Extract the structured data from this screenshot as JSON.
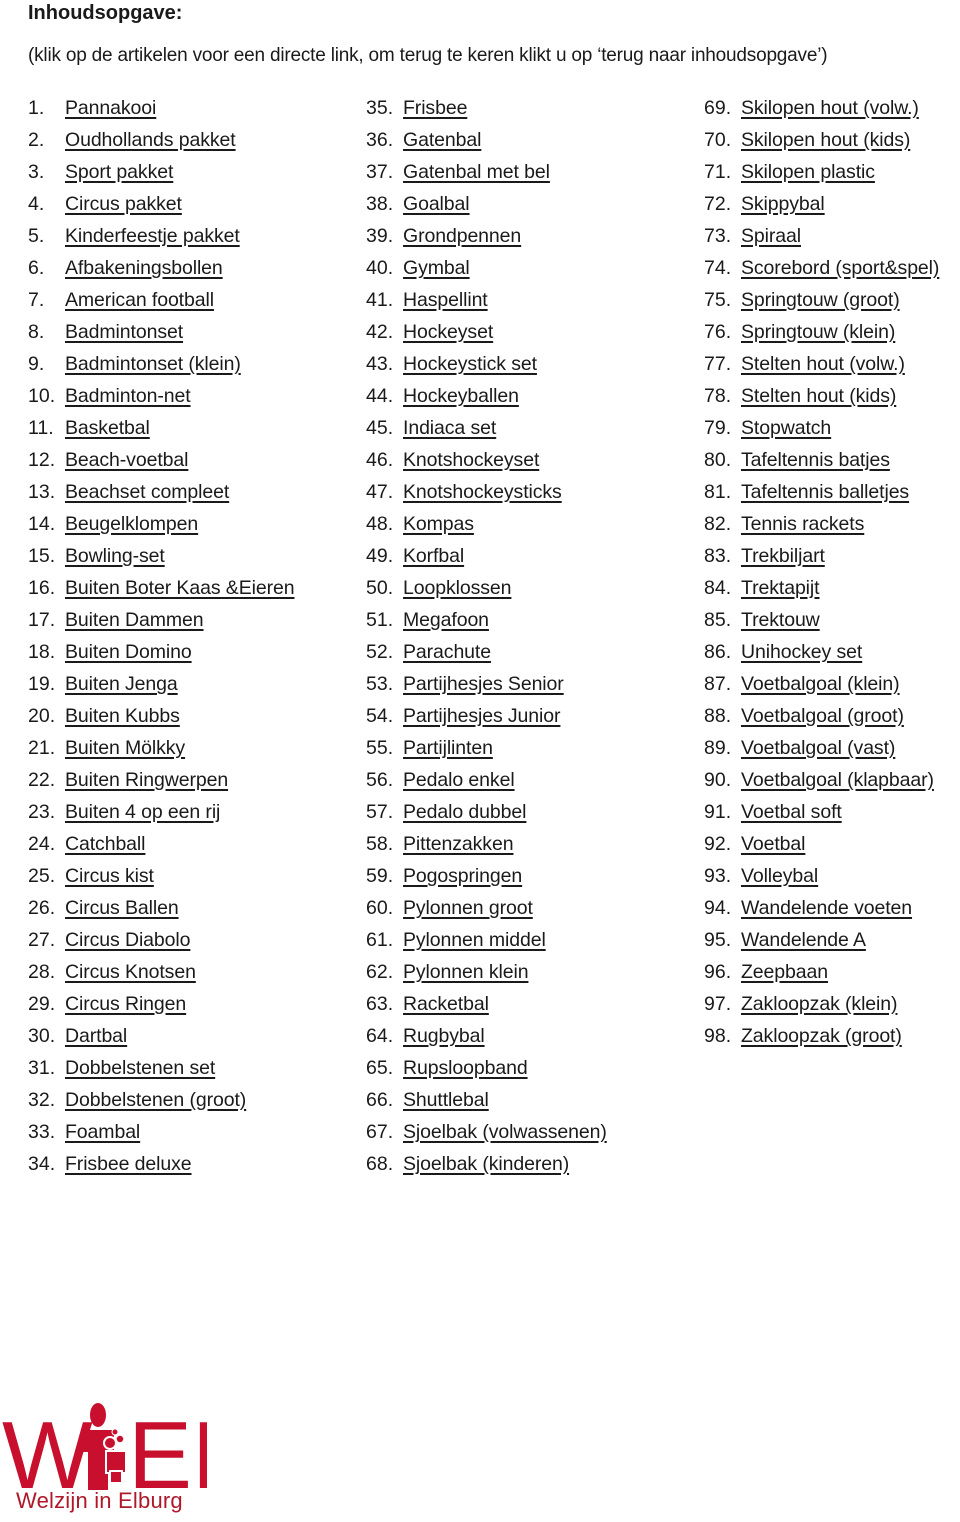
{
  "title": "Inhoudsopgave:",
  "subtitle": "(klik op de artikelen voor een directe link, om terug te keren klikt u op ‘terug naar inhoudsopgave’)",
  "columns": [
    {
      "items": [
        {
          "num": "1.",
          "label": "Pannakooi"
        },
        {
          "num": "2.",
          "label": "Oudhollands pakket"
        },
        {
          "num": "3.",
          "label": "Sport pakket"
        },
        {
          "num": "4.",
          "label": "Circus pakket"
        },
        {
          "num": "5.",
          "label": "Kinderfeestje pakket"
        },
        {
          "num": "6.",
          "label": "Afbakeningsbollen"
        },
        {
          "num": "7.",
          "label": "American football"
        },
        {
          "num": "8.",
          "label": "Badmintonset"
        },
        {
          "num": "9.",
          "label": "Badmintonset (klein)"
        },
        {
          "num": "10.",
          "label": "Badminton-net"
        },
        {
          "num": "11.",
          "label": "Basketbal"
        },
        {
          "num": "12.",
          "label": "Beach-voetbal"
        },
        {
          "num": "13.",
          "label": "Beachset compleet"
        },
        {
          "num": "14.",
          "label": "Beugelklompen"
        },
        {
          "num": "15.",
          "label": "Bowling-set"
        },
        {
          "num": "16.",
          "label": "Buiten Boter Kaas &Eieren"
        },
        {
          "num": "17.",
          "label": "Buiten Dammen"
        },
        {
          "num": "18.",
          "label": "Buiten Domino"
        },
        {
          "num": "19.",
          "label": "Buiten Jenga"
        },
        {
          "num": "20.",
          "label": "Buiten Kubbs"
        },
        {
          "num": "21.",
          "label": "Buiten Mölkky"
        },
        {
          "num": "22.",
          "label": "Buiten Ringwerpen"
        },
        {
          "num": "23.",
          "label": "Buiten 4 op een rij"
        },
        {
          "num": "24.",
          "label": "Catchball"
        },
        {
          "num": "25.",
          "label": "Circus kist"
        },
        {
          "num": "26.",
          "label": "Circus Ballen"
        },
        {
          "num": "27.",
          "label": "Circus Diabolo"
        },
        {
          "num": "28.",
          "label": "Circus Knotsen"
        },
        {
          "num": "29.",
          "label": "Circus Ringen"
        },
        {
          "num": "30.",
          "label": "Dartbal"
        },
        {
          "num": "31.",
          "label": "Dobbelstenen set"
        },
        {
          "num": "32.",
          "label": "Dobbelstenen (groot)"
        },
        {
          "num": "33.",
          "label": "Foambal"
        },
        {
          "num": "34.",
          "label": "Frisbee deluxe"
        }
      ]
    },
    {
      "items": [
        {
          "num": "35.",
          "label": "Frisbee"
        },
        {
          "num": "36.",
          "label": "Gatenbal"
        },
        {
          "num": "37.",
          "label": "Gatenbal met bel"
        },
        {
          "num": "38.",
          "label": "Goalbal"
        },
        {
          "num": "39.",
          "label": "Grondpennen"
        },
        {
          "num": "40.",
          "label": "Gymbal"
        },
        {
          "num": "41.",
          "label": "Haspellint"
        },
        {
          "num": "42.",
          "label": "Hockeyset"
        },
        {
          "num": "43.",
          "label": "Hockeystick set"
        },
        {
          "num": "44.",
          "label": "Hockeyballen"
        },
        {
          "num": "45.",
          "label": "Indiaca set"
        },
        {
          "num": "46.",
          "label": "Knotshockeyset"
        },
        {
          "num": "47.",
          "label": "Knotshockeysticks"
        },
        {
          "num": "48.",
          "label": "Kompas"
        },
        {
          "num": "49.",
          "label": "Korfbal"
        },
        {
          "num": "50.",
          "label": "Loopklossen"
        },
        {
          "num": "51.",
          "label": "Megafoon"
        },
        {
          "num": "52.",
          "label": "Parachute"
        },
        {
          "num": "53.",
          "label": "Partijhesjes Senior"
        },
        {
          "num": "54.",
          "label": "Partijhesjes Junior"
        },
        {
          "num": "55.",
          "label": "Partijlinten"
        },
        {
          "num": "56.",
          "label": "Pedalo enkel"
        },
        {
          "num": "57.",
          "label": "Pedalo dubbel"
        },
        {
          "num": "58.",
          "label": "Pittenzakken"
        },
        {
          "num": "59.",
          "label": "Pogospringen"
        },
        {
          "num": "60.",
          "label": "Pylonnen groot"
        },
        {
          "num": "61.",
          "label": "Pylonnen middel"
        },
        {
          "num": "62.",
          "label": "Pylonnen klein"
        },
        {
          "num": "63.",
          "label": "Racketbal"
        },
        {
          "num": "64.",
          "label": "Rugbybal"
        },
        {
          "num": "65.",
          "label": "Rupsloopband"
        },
        {
          "num": "66.",
          "label": "Shuttlebal"
        },
        {
          "num": "67.",
          "label": "Sjoelbak (volwassenen)"
        },
        {
          "num": "68.",
          "label": "Sjoelbak (kinderen)"
        }
      ]
    },
    {
      "items": [
        {
          "num": "69.",
          "label": "Skilopen hout (volw.)"
        },
        {
          "num": "70.",
          "label": "Skilopen hout (kids)"
        },
        {
          "num": "71.",
          "label": "Skilopen plastic"
        },
        {
          "num": "72.",
          "label": "Skippybal"
        },
        {
          "num": "73.",
          "label": "Spiraal"
        },
        {
          "num": "74.",
          "label": "Scorebord (sport&spel)"
        },
        {
          "num": "75.",
          "label": "Springtouw (groot)"
        },
        {
          "num": "76.",
          "label": "Springtouw (klein)"
        },
        {
          "num": "77.",
          "label": "Stelten hout (volw.)"
        },
        {
          "num": "78.",
          "label": "Stelten hout (kids)"
        },
        {
          "num": "79.",
          "label": "Stopwatch"
        },
        {
          "num": "80.",
          "label": "Tafeltennis batjes"
        },
        {
          "num": "81.",
          "label": "Tafeltennis balletjes"
        },
        {
          "num": "82.",
          "label": "Tennis rackets"
        },
        {
          "num": "83.",
          "label": "Trekbiljart"
        },
        {
          "num": "84.",
          "label": "Trektapijt"
        },
        {
          "num": "85.",
          "label": "Trektouw"
        },
        {
          "num": "86.",
          "label": "Unihockey set"
        },
        {
          "num": "87.",
          "label": "Voetbalgoal (klein)"
        },
        {
          "num": "88.",
          "label": "Voetbalgoal (groot)"
        },
        {
          "num": "89.",
          "label": "Voetbalgoal (vast)"
        },
        {
          "num": "90.",
          "label": "Voetbalgoal (klapbaar)"
        },
        {
          "num": "91.",
          "label": "Voetbal soft"
        },
        {
          "num": "92.",
          "label": "Voetbal"
        },
        {
          "num": "93.",
          "label": "Volleybal"
        },
        {
          "num": "94.",
          "label": "Wandelende voeten"
        },
        {
          "num": "95.",
          "label": "Wandelende A"
        },
        {
          "num": "96.",
          "label": "Zeepbaan"
        },
        {
          "num": "97.",
          "label": "Zakloopzak (klein)"
        },
        {
          "num": "98.",
          "label": "Zakloopzak (groot)"
        }
      ]
    }
  ],
  "logo": {
    "letters_left": "W",
    "letters_right": "EL",
    "tagline": "Welzijn in Elburg",
    "brand_color": "#c8102e",
    "icon": "family-figures-icon"
  }
}
